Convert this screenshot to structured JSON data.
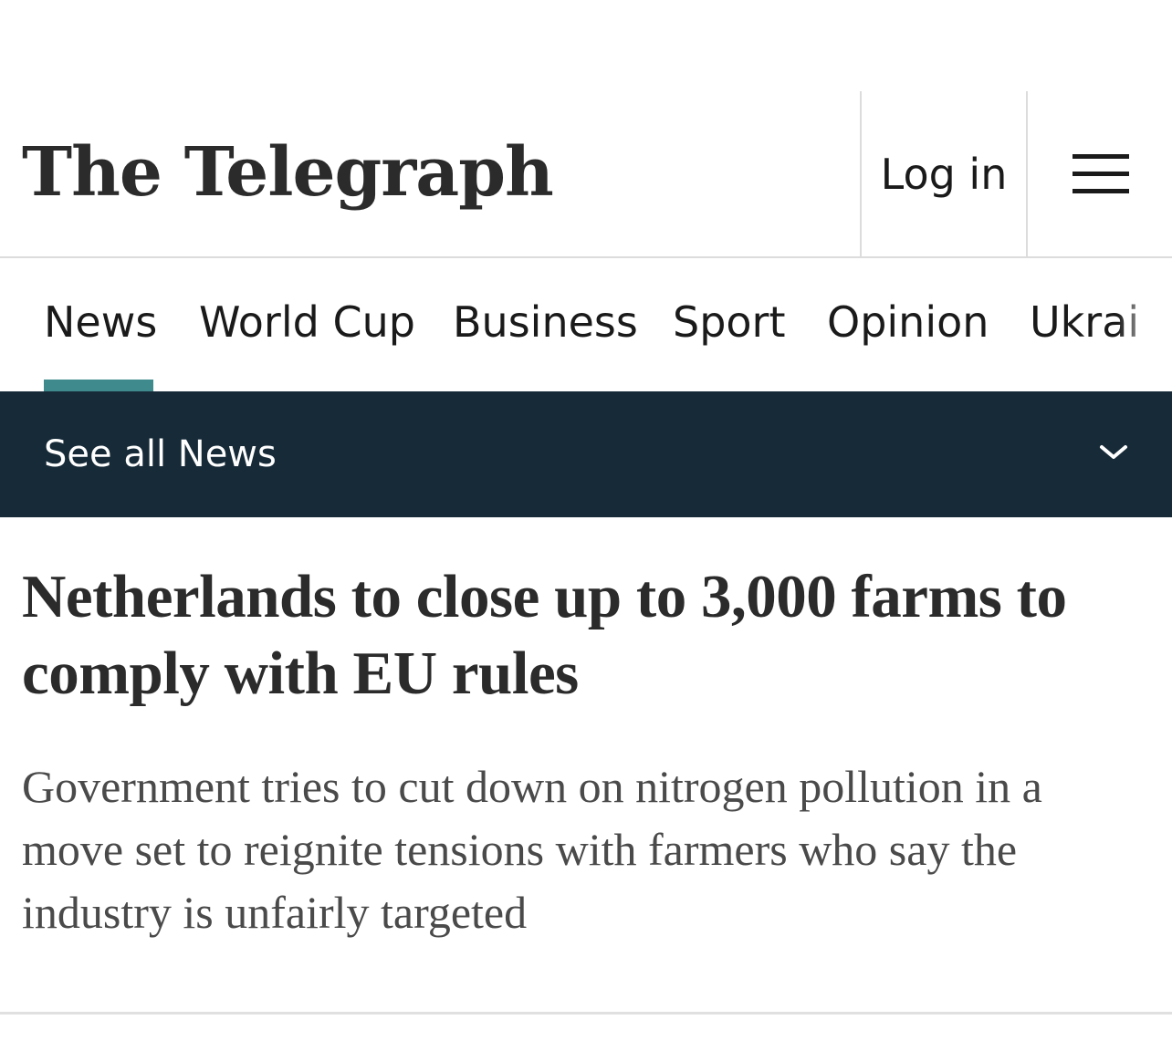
{
  "header": {
    "logo_text": "The Telegraph",
    "login_label": "Log in",
    "menu_icon": "hamburger-menu-icon"
  },
  "nav": {
    "items": [
      {
        "label": "News",
        "active": true
      },
      {
        "label": "World Cup"
      },
      {
        "label": "Business"
      },
      {
        "label": "Sport"
      },
      {
        "label": "Opinion"
      },
      {
        "label": "Ukrai"
      }
    ],
    "active_color": "#3f8a8c"
  },
  "section_bar": {
    "label": "See all News",
    "icon": "chevron-down-icon",
    "background": "#162a38"
  },
  "article": {
    "headline": "Netherlands to close up to 3,000 farms to comply with EU rules",
    "standfirst": "Government tries to cut down on nitrogen pollution in a move set to reignite tensions with farmers who say the industry is unfairly targeted"
  }
}
